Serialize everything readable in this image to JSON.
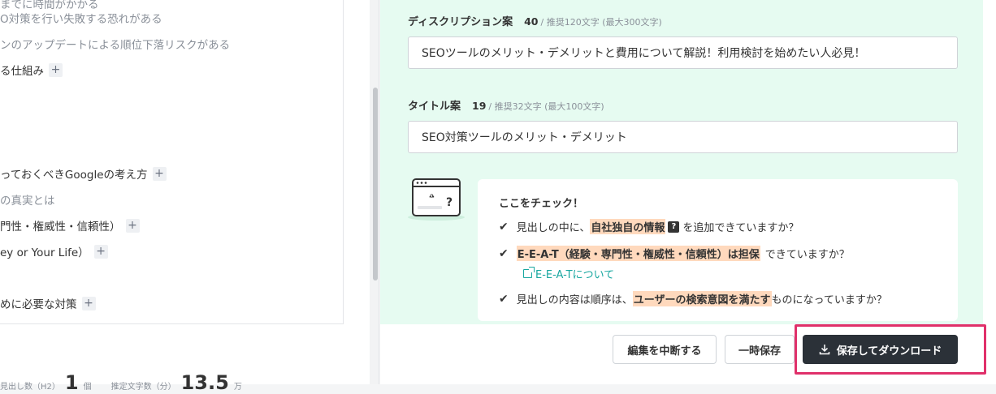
{
  "outline": {
    "items": [
      {
        "text": "までに時間がかかる",
        "sub": false,
        "plus": false
      },
      {
        "text": "O対策を行い失敗する恐れがある",
        "sub": true,
        "plus": false
      },
      {
        "text": "ンのアップデートによる順位下落リスクがある",
        "sub": true,
        "plus": false
      },
      {
        "text": "る仕組み",
        "sub": false,
        "plus": true
      },
      {
        "text": "っておくべきGoogleの考え方",
        "sub": false,
        "plus": true
      },
      {
        "text": "の真実とは",
        "sub": true,
        "plus": false
      },
      {
        "text": "門性・権威性・信頼性）",
        "sub": false,
        "plus": true
      },
      {
        "text": "ey or Your Life）",
        "sub": false,
        "plus": true
      },
      {
        "text": "めに必要な対策",
        "sub": false,
        "plus": true
      }
    ],
    "plus_symbol": "+"
  },
  "footer_stats": {
    "label_1": "見出し数（H2）",
    "value_1": "1",
    "unit_1": "個",
    "label_2": "推定文字数（分）",
    "value_2": "13.5",
    "unit_2": "万"
  },
  "editor": {
    "description": {
      "label": "ディスクリプション案",
      "count": "40",
      "recommend": "/ 推奨120文字 (最大300文字)",
      "value": "SEOツールのメリット・デメリットと費用について解説！利用検討を始めたい人必見！"
    },
    "title": {
      "label": "タイトル案",
      "count": "19",
      "recommend": "/ 推奨32文字 (最大100文字)",
      "value": "SEO対策ツールのメリット・デメリット"
    }
  },
  "check": {
    "title": "ここをチェック！",
    "tick": "✔",
    "item1": {
      "pre": "見出しの中に、",
      "highlight": "自社独自の情報",
      "badge": "?",
      "post": "を追加できていますか？"
    },
    "item2": {
      "highlight": "E-E-A-T（経験・専門性・権威性・信頼性）は担保",
      "post": "できていますか？"
    },
    "link": "E-E-A-Tについて",
    "item3": {
      "pre": "見出しの内容は順序は、",
      "highlight": "ユーザーの検索意図を満たす",
      "post": "ものになっていますか？"
    }
  },
  "buttons": {
    "cancel": "編集を中断する",
    "temp_save": "一時保存",
    "save_download": "保存してダウンロード"
  },
  "colors": {
    "mint_bg": "#e6fbf1",
    "highlight": "#ffd9bd",
    "link": "#19a7a0",
    "dark_button": "#2b3138",
    "annotation_box": "#e0306a"
  }
}
